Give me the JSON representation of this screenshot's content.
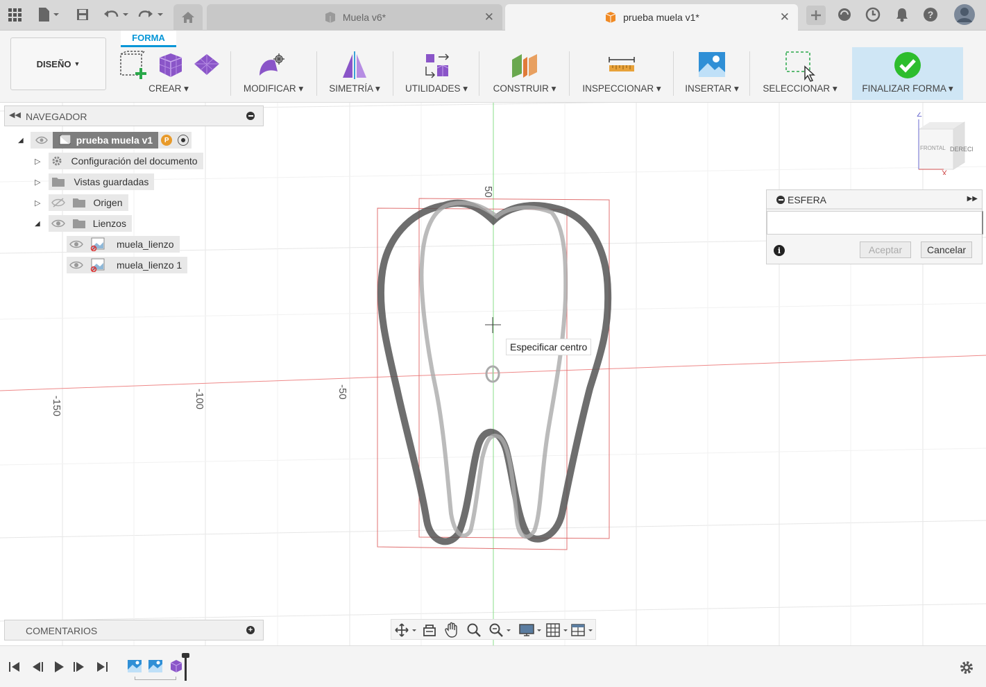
{
  "tabs": [
    {
      "label": "Muela v6*",
      "active": false
    },
    {
      "label": "prueba muela v1*",
      "active": true
    }
  ],
  "toolbar": {
    "design_label": "DISEÑO",
    "forma_tab": "FORMA",
    "groups": {
      "crear": "CREAR",
      "modificar": "MODIFICAR",
      "simetria": "SIMETRÍA",
      "utilidades": "UTILIDADES",
      "construir": "CONSTRUIR",
      "inspeccionar": "INSPECCIONAR",
      "insertar": "INSERTAR",
      "seleccionar": "SELECCIONAR",
      "finalizar": "FINALIZAR FORMA"
    }
  },
  "navigator": {
    "title": "NAVEGADOR",
    "root": "prueba muela v1",
    "items": [
      {
        "label": "Configuración del documento"
      },
      {
        "label": "Vistas guardadas"
      },
      {
        "label": "Origen"
      },
      {
        "label": "Lienzos"
      },
      {
        "label": "muela_lienzo"
      },
      {
        "label": "muela_lienzo 1"
      }
    ]
  },
  "esfera": {
    "title": "ESFERA",
    "accept": "Aceptar",
    "cancel": "Cancelar"
  },
  "tooltip": "Especificar centro",
  "viewcube": {
    "face": "DERECHA",
    "face2": "FRONTAL",
    "z": "Z",
    "x": "X"
  },
  "axis_labels": {
    "y50": "50",
    "xm50": "-50",
    "xm100": "-100",
    "xm150": "-150"
  },
  "comentarios": "COMENTARIOS",
  "colors": {
    "accent": "#0696d7",
    "finish_bg": "#cfe6f5",
    "check": "#2dbd2d"
  }
}
